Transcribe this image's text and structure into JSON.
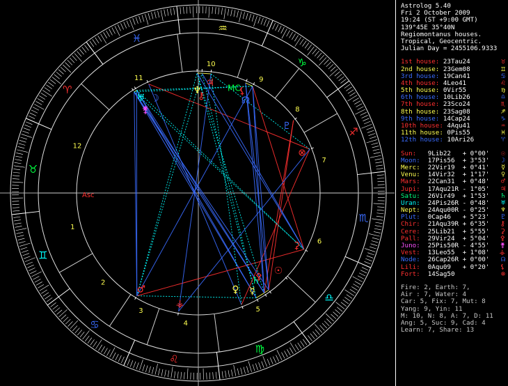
{
  "header": [
    "Astrolog 5.40",
    "Fri 2 October 2009",
    "19:24 (ST +9:00 GMT)",
    "139°45E 35°40N",
    "Regiomontanus houses.",
    "Tropical, Geocentric.",
    "Julian Day = 2455106.9333"
  ],
  "houses": [
    {
      "label": "1st house:",
      "value": "23Tau24",
      "symbol": "♉",
      "color": "#ff3030"
    },
    {
      "label": "2nd house:",
      "value": "23Gem08",
      "symbol": "♊",
      "color": "#ffff50"
    },
    {
      "label": "3rd house:",
      "value": "19Can41",
      "symbol": "♋",
      "color": "#3a6cff"
    },
    {
      "label": "4th house:",
      "value": "4Leo41",
      "symbol": "♌",
      "color": "#ff3030"
    },
    {
      "label": "5th house:",
      "value": "0Vir55",
      "symbol": "♍",
      "color": "#ffff50"
    },
    {
      "label": "6th house:",
      "value": "10Lib26",
      "symbol": "♎",
      "color": "#3a6cff"
    },
    {
      "label": "7th house:",
      "value": "23Sco24",
      "symbol": "♏",
      "color": "#ff3030"
    },
    {
      "label": "8th house:",
      "value": "23Sag08",
      "symbol": "♐",
      "color": "#ffff50"
    },
    {
      "label": "9th house:",
      "value": "14Cap24",
      "symbol": "♑",
      "color": "#3a6cff"
    },
    {
      "label": "10th house:",
      "value": "4Aqu41",
      "symbol": "♒",
      "color": "#ff3030"
    },
    {
      "label": "11th house:",
      "value": "0Pis55",
      "symbol": "♓",
      "color": "#ffff50"
    },
    {
      "label": "12th house:",
      "value": "10Ari26",
      "symbol": "♈",
      "color": "#3a6cff"
    }
  ],
  "planets": [
    {
      "name": "Sun:",
      "pos": "9Lib22",
      "ret": "",
      "lat": "+ 0°00'",
      "symbol": "☉",
      "color": "#ff3030"
    },
    {
      "name": "Moon:",
      "pos": "17Pis56",
      "ret": "",
      "lat": "+ 3°53'",
      "symbol": "☽",
      "color": "#3a6cff"
    },
    {
      "name": "Merc:",
      "pos": "22Vir19",
      "ret": "",
      "lat": "+ 0°41'",
      "symbol": "☿",
      "color": "#ffff50"
    },
    {
      "name": "Venu:",
      "pos": "14Vir32",
      "ret": "",
      "lat": "+ 1°17'",
      "symbol": "♀",
      "color": "#ffff50"
    },
    {
      "name": "Mars:",
      "pos": "22Can31",
      "ret": "",
      "lat": "+ 0°48'",
      "symbol": "♂",
      "color": "#ff3030"
    },
    {
      "name": "Jupi:",
      "pos": "17Aqu21",
      "ret": "R",
      "lat": "- 1°05'",
      "symbol": "♃",
      "color": "#ff3030"
    },
    {
      "name": "Satu:",
      "pos": "26Vir49",
      "ret": "",
      "lat": "+ 1°53'",
      "symbol": "♄",
      "color": "#00ff80"
    },
    {
      "name": "Uran:",
      "pos": "24Pis26",
      "ret": "R",
      "lat": "- 0°48'",
      "symbol": "♅",
      "color": "#00ffff"
    },
    {
      "name": "Nept:",
      "pos": "24Aqu00",
      "ret": "R",
      "lat": "- 0°25'",
      "symbol": "♆",
      "color": "#ffff50"
    },
    {
      "name": "Plut:",
      "pos": "0Cap46",
      "ret": "",
      "lat": "+ 5°23'",
      "symbol": "♇",
      "color": "#3a6cff"
    },
    {
      "name": "Chir:",
      "pos": "21Aqu39",
      "ret": "R",
      "lat": "+ 6°35'",
      "symbol": "⚷",
      "color": "#ff3030"
    },
    {
      "name": "Cere:",
      "pos": "25Lib21",
      "ret": "",
      "lat": "+ 5°55'",
      "symbol": "⚳",
      "color": "#ff3030"
    },
    {
      "name": "Pall:",
      "pos": "29Vir24",
      "ret": "",
      "lat": "+ 5°04'",
      "symbol": "⚴",
      "color": "#ff3030"
    },
    {
      "name": "Juno:",
      "pos": "25Pis50",
      "ret": "R",
      "lat": "- 4°55'",
      "symbol": "⚵",
      "color": "#ff50ff"
    },
    {
      "name": "Vest:",
      "pos": "13Leo55",
      "ret": "",
      "lat": "+ 1°08'",
      "symbol": "⚶",
      "color": "#ff3030"
    },
    {
      "name": "Node:",
      "pos": "26Cap26",
      "ret": "R",
      "lat": "+ 0°00'",
      "symbol": "☊",
      "color": "#3a6cff"
    },
    {
      "name": "Lili:",
      "pos": "0Aqu09",
      "ret": "",
      "lat": "+ 0°20'",
      "symbol": "⚸",
      "color": "#ff3030"
    },
    {
      "name": "Fort:",
      "pos": "14Sag50",
      "ret": "",
      "lat": "",
      "symbol": "⊗",
      "color": "#ff3030"
    }
  ],
  "stats": [
    "Fire: 2, Earth: 7,",
    "Air : 7, Water: 4",
    "Car: 5, Fix: 7, Mut: 8",
    "Yang: 9, Yin: 11",
    "M: 10, N: 8, A: 7, D: 11",
    "Ang: 5, Suc: 9, Cad: 4",
    "Learn: 7, Share: 13"
  ],
  "wheel": {
    "asc_label": "Asc",
    "mc_label": "MC",
    "house_numbers": [
      "1",
      "2",
      "3",
      "4",
      "5",
      "6",
      "7",
      "8",
      "9",
      "10",
      "11",
      "12"
    ],
    "signs": [
      {
        "name": "Aries",
        "glyph": "♈",
        "color": "#ff3030"
      },
      {
        "name": "Taurus",
        "glyph": "♉",
        "color": "#00ff40"
      },
      {
        "name": "Gemini",
        "glyph": "♊",
        "color": "#00ffff"
      },
      {
        "name": "Cancer",
        "glyph": "♋",
        "color": "#3a6cff"
      },
      {
        "name": "Leo",
        "glyph": "♌",
        "color": "#ff3030"
      },
      {
        "name": "Virgo",
        "glyph": "♍",
        "color": "#00ff40"
      },
      {
        "name": "Libra",
        "glyph": "♎",
        "color": "#00ffff"
      },
      {
        "name": "Scorpio",
        "glyph": "♏",
        "color": "#3a6cff"
      },
      {
        "name": "Sagittarius",
        "glyph": "♐",
        "color": "#ff3030"
      },
      {
        "name": "Capricorn",
        "glyph": "♑",
        "color": "#00ff40"
      },
      {
        "name": "Aquarius",
        "glyph": "♒",
        "color": "#ffff50"
      },
      {
        "name": "Pisces",
        "glyph": "♓",
        "color": "#3a6cff"
      }
    ]
  }
}
